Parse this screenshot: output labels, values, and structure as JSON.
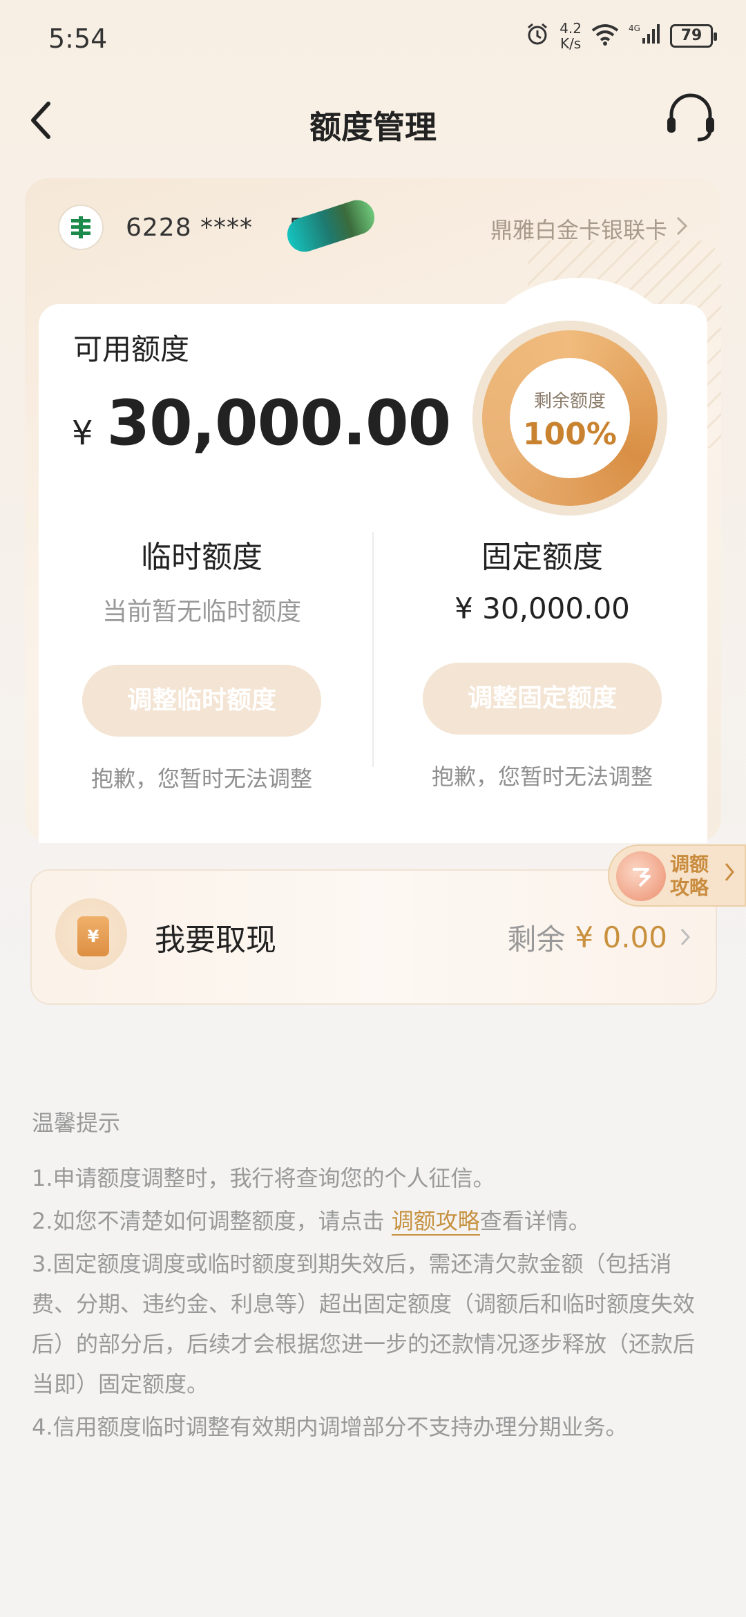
{
  "status": {
    "time": "5:54",
    "net_speed_value": "4.2",
    "net_speed_unit": "K/s",
    "signal": "4G",
    "battery": "79"
  },
  "nav": {
    "title": "额度管理",
    "back_icon": "back-arrow-icon",
    "service_icon": "headset-icon"
  },
  "card": {
    "number": "6228 ****",
    "number_tail": "52",
    "type": "鼎雅白金卡银联卡",
    "bank_logo": "bank-logo-icon"
  },
  "limit": {
    "available_label": "可用额度",
    "currency": "¥",
    "available_amount": "30,000.00",
    "remaining_label": "剩余额度",
    "remaining_percent": "100%"
  },
  "temporary": {
    "title": "临时额度",
    "status": "当前暂无临时额度",
    "button": "调整临时额度",
    "note": "抱歉，您暂时无法调整"
  },
  "fixed": {
    "title": "固定额度",
    "value": "¥ 30,000.00",
    "button": "调整固定额度",
    "note": "抱歉，您暂时无法调整"
  },
  "withdraw": {
    "label": "我要取现",
    "remaining_label": "剩余",
    "remaining_amount": "¥ 0.00"
  },
  "guide_tab": {
    "label": "调额攻略",
    "line1": "调额",
    "line2": "攻略"
  },
  "tips": {
    "title": "温馨提示",
    "item1": "1.申请额度调整时，我行将查询您的个人征信。",
    "item2_before": "2.如您不清楚如何调整额度，请点击 ",
    "item2_link": "调额攻略",
    "item2_after": "查看详情。",
    "item3": "3.固定额度调度或临时额度到期失效后，需还清欠款金额（包括消费、分期、违约金、利息等）超出固定额度（调额后和临时额度失效后）的部分后，后续才会根据您进一步的还款情况逐步释放（还款后当即）固定额度。",
    "item4": "4.信用额度临时调整有效期内调增部分不支持办理分期业务。"
  }
}
